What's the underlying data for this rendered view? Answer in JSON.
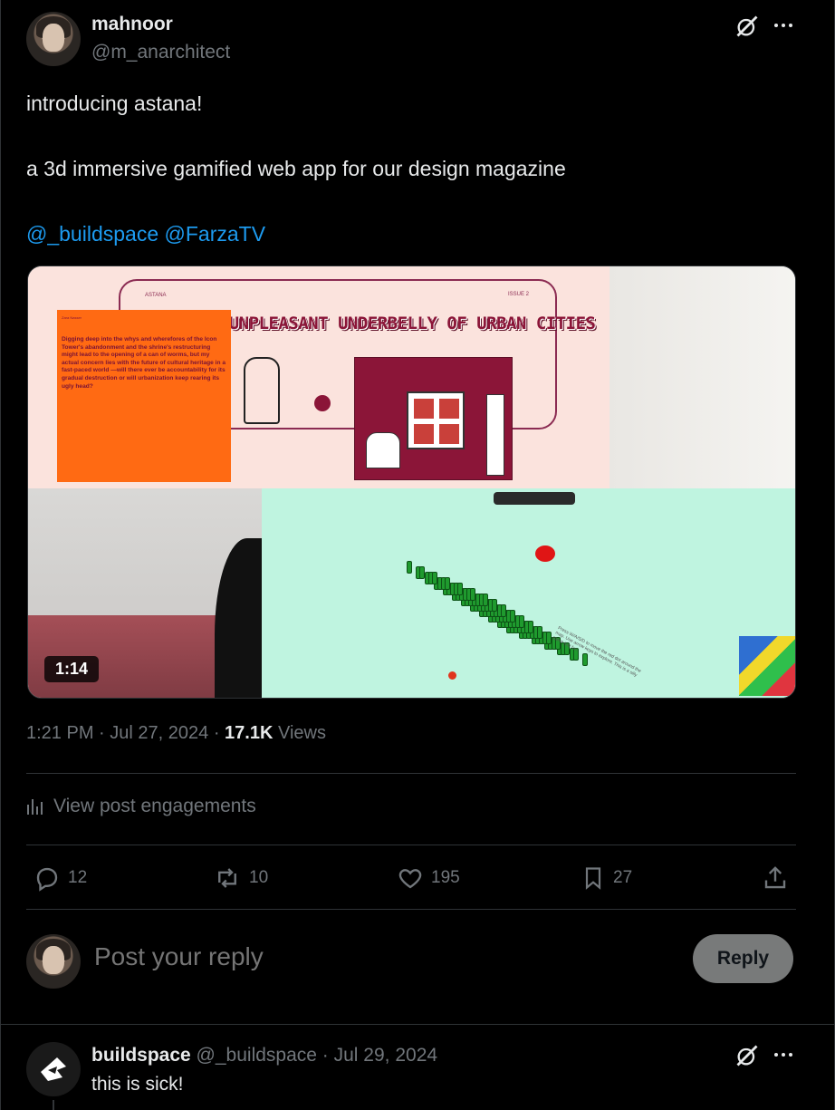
{
  "post": {
    "author_name": "mahnoor",
    "author_handle": "@m_anarchitect",
    "text_line1": "introducing astana!",
    "text_line2": "a 3d immersive gamified web app for our design magazine",
    "mention1": "@_buildspace",
    "mention2": "@FarzaTV",
    "video_duration": "1:14",
    "time": "1:21 PM",
    "date": "Jul 27, 2024",
    "views_count": "17.1K",
    "views_label": "Views",
    "engagements_label": "View post engagements"
  },
  "media": {
    "magazine_left": "ASTANA",
    "magazine_right": "ISSUE 2",
    "magazine_title": "THE UNPLEASANT UNDERBELLY OF URBAN CITIES",
    "box_tag": "Zara Nasser",
    "box_text": "Digging deep into the whys and wherefores of the Icon Tower's abandonment and the shrine's restructuring might lead to the opening of a can of worms, but my actual concern lies with the future of cultural heritage in a fast-paced world —will there ever be accountability for its gradual destruction or will urbanization keep rearing its ugly head?",
    "map_note": "Press W/A/S/D to move the red dot around the map. Use arrow keys to explore. This is a silly game just fun."
  },
  "actions": {
    "replies": "12",
    "reposts": "10",
    "likes": "195",
    "bookmarks": "27"
  },
  "composer": {
    "placeholder": "Post your reply",
    "button_label": "Reply"
  },
  "reply": {
    "author_name": "buildspace",
    "author_handle": "@_buildspace",
    "date": "Jul 29, 2024",
    "text": "this is sick!"
  },
  "colors": {
    "background": "#000000",
    "text": "#e7e9ea",
    "muted": "#71767b",
    "link": "#1d9bf0",
    "divider": "#2f3336"
  }
}
